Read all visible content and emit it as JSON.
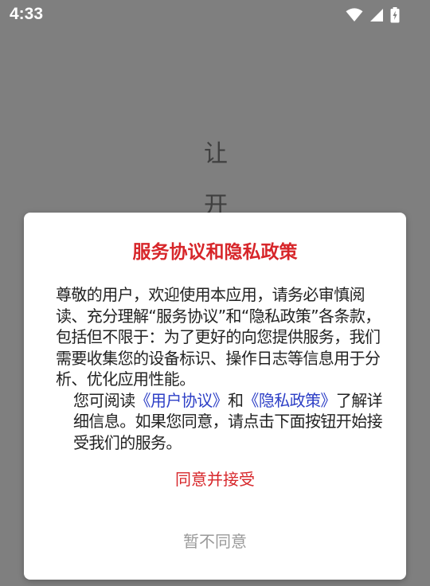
{
  "status_bar": {
    "time": "4:33",
    "icons": [
      "wifi-icon",
      "signal-icon",
      "battery-charging-icon"
    ]
  },
  "background": {
    "line1": "让",
    "line2": "开"
  },
  "dialog": {
    "title": "服务协议和隐私政策",
    "para1": "尊敬的用户，欢迎使用本应用，请务必审慎阅读、充分理解“服务协议”和“隐私政策”各条款，包括但不限于：为了更好的向您提供服务，我们需要收集您的设备标识、操作日志等信息用于分析、优化应用性能。",
    "para2_prefix": "您可阅读",
    "user_agreement_link": "《用户协议》",
    "para2_and": "和",
    "privacy_policy_link": "《隐私政策》",
    "para2_suffix": "了解详细信息。如果您同意，请点击下面按钮开始接受我们的服务。",
    "agree_button": "同意并接受",
    "decline_button": "暂不同意"
  },
  "colors": {
    "title": "#d7262a",
    "link": "#2d3fc6",
    "agree": "#d7262a",
    "decline": "#9a9a9a",
    "overlay": "#7f7f7f"
  }
}
